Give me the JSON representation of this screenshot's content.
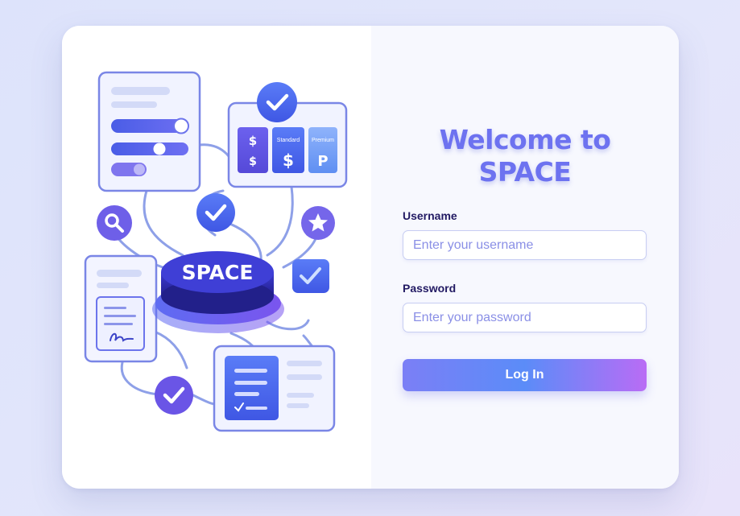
{
  "illustration": {
    "logo_text": "SPACE",
    "plans": [
      {
        "name": "",
        "symbol": "$"
      },
      {
        "name": "Standard",
        "symbol": "$"
      },
      {
        "name": "Premium",
        "symbol": "P"
      }
    ]
  },
  "login": {
    "title_line1": "Welcome to",
    "title_line2": "SPACE",
    "username_label": "Username",
    "username_placeholder": "Enter your username",
    "password_label": "Password",
    "password_placeholder": "Enter your password",
    "submit_label": "Log In"
  },
  "colors": {
    "accent": "#6d72f0",
    "label": "#221a63",
    "button_start": "#7b7ff6",
    "button_end": "#b96cf5"
  }
}
